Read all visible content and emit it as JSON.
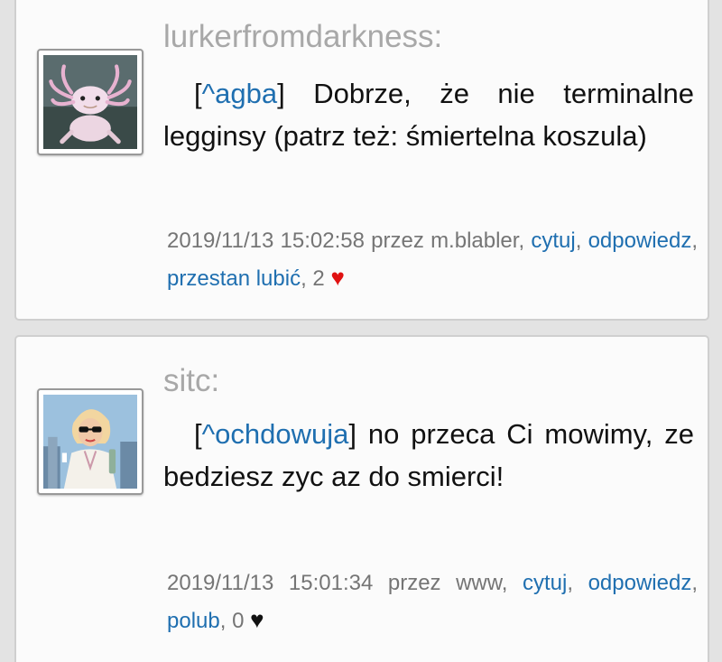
{
  "comments": [
    {
      "author": "lurkerfromdarkness:",
      "avatar": "axolotl-avatar",
      "body_bracket_open": "[",
      "body_mention": "^agba",
      "body_bracket_close": "]",
      "body_text": " Dobrze, że nie terminalne legginsy (patrz też: śmiertelna koszula)",
      "timestamp": "2019/11/13 15:02:58",
      "by_prefix": "przez",
      "by_user": "m.blabler,",
      "quote_label": "cytuj",
      "reply_label": "odpowiedz",
      "like_label": "przestan lubić",
      "like_count": "2",
      "heart_glyph": "♥",
      "heart_color": "#e01212"
    },
    {
      "author": "sitc:",
      "avatar": "woman-sunglasses-avatar",
      "body_bracket_open": "[",
      "body_mention": "^ochdowuja",
      "body_bracket_close": "]",
      "body_text": " no przeca Ci mowimy, ze bedziesz zyc az do smierci!",
      "timestamp": "2019/11/13 15:01:34",
      "by_prefix": "przez",
      "by_user": "www,",
      "quote_label": "cytuj",
      "reply_label": "odpowiedz",
      "like_label": "polub",
      "like_count": "0",
      "heart_glyph": "♥",
      "heart_color": "#111111"
    }
  ]
}
